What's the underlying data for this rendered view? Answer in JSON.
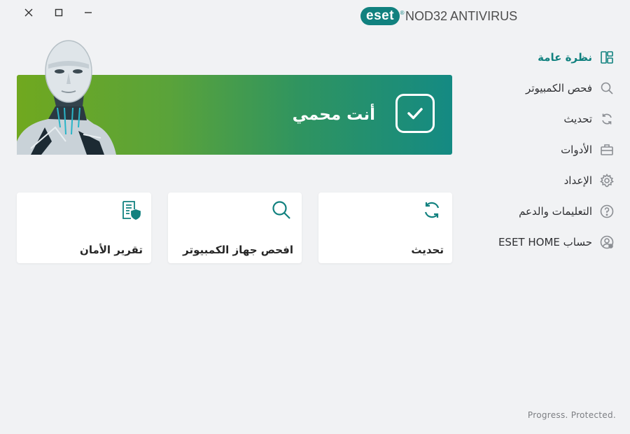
{
  "window": {
    "close_icon": "close-icon",
    "maximize_icon": "maximize-icon",
    "minimize_icon": "minimize-icon"
  },
  "brand": {
    "logo_text": "eset",
    "registered": "®",
    "product_name": "NOD32 ANTIVIRUS",
    "accent_color": "#11817f"
  },
  "sidebar": {
    "items": [
      {
        "label": "نظرة عامة",
        "icon": "overview-icon",
        "active": true
      },
      {
        "label": "فحص الكمبيوتر",
        "icon": "search-icon",
        "active": false
      },
      {
        "label": "تحديث",
        "icon": "refresh-icon",
        "active": false
      },
      {
        "label": "الأدوات",
        "icon": "toolbox-icon",
        "active": false
      },
      {
        "label": "الإعداد",
        "icon": "gear-icon",
        "active": false
      },
      {
        "label": "التعليمات والدعم",
        "icon": "help-icon",
        "active": false
      },
      {
        "label": "حساب ESET HOME",
        "icon": "account-icon",
        "active": false
      }
    ]
  },
  "status": {
    "text": "أنت محمي",
    "icon": "checkmark-icon",
    "gradient_start": "#70a81f",
    "gradient_end": "#148a83"
  },
  "cards": [
    {
      "label": "تحديث",
      "icon": "refresh-icon"
    },
    {
      "label": "افحص جهاز الكمبيوتر",
      "icon": "search-icon"
    },
    {
      "label": "تقرير الأمان",
      "icon": "security-report-icon"
    }
  ],
  "footer": {
    "tagline": "Progress. Protected."
  }
}
